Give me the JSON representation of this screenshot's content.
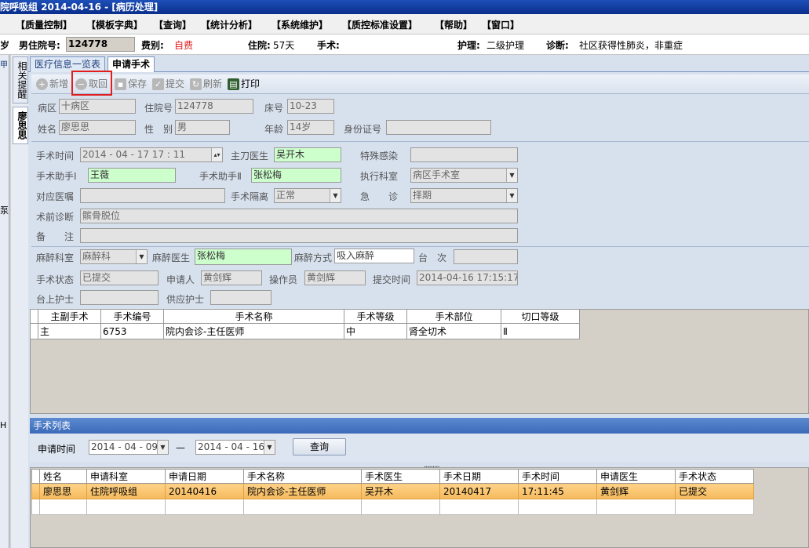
{
  "titlebar": {
    "text": "院呼吸组  2014-04-16 - [病历处理]"
  },
  "menu": [
    "【质量控制】",
    "【模板字典】",
    "【查询】",
    "【统计分析】",
    "【系统维护】",
    "【质控标准设置】",
    "【帮助】",
    "【窗口】"
  ],
  "patient": {
    "age_suffix": "岁",
    "sex_label": "男住院号:",
    "id": "124778",
    "fee_label": "费别:",
    "fee": "自费",
    "stay_label": "住院:",
    "stay": "57天",
    "surgery_label": "手术:",
    "nursing_label": "护理:",
    "nursing": "二级护理",
    "diag_label": "诊断:",
    "diag": "社区获得性肺炎，非重症"
  },
  "left_strip": {
    "t1": "甲",
    "t2": "泵",
    "t3": "H"
  },
  "vtabs": {
    "related": "相关提醒",
    "name": "廖思思"
  },
  "tabs": {
    "overview": "医疗信息一览表",
    "apply": "申请手术"
  },
  "toolbar": {
    "add": "新增",
    "withdraw": "取回",
    "save": "保存",
    "submit": "提交",
    "refresh": "刷新",
    "print": "打印"
  },
  "form": {
    "ward_l": "病区",
    "ward": "十病区",
    "inp_l": "住院号",
    "inp": "124778",
    "bed_l": "床号",
    "bed": "10-23",
    "name_l": "姓名",
    "name": "廖思思",
    "sex_l": "性　别",
    "sex": "男",
    "age_l": "年龄",
    "age": "14岁",
    "idcard_l": "身份证号",
    "optime_l": "手术时间",
    "optime": "2014 - 04 - 17    17 : 11",
    "surgeon_l": "主刀医生",
    "surgeon": "吴开木",
    "infect_l": "特殊感染",
    "asst1_l": "手术助手Ⅰ",
    "asst1": "王薇",
    "asst2_l": "手术助手Ⅱ",
    "asst2": "张松梅",
    "dept_l": "执行科室",
    "dept": "病区手术室",
    "order_l": "对应医嘱",
    "iso_l": "手术隔离",
    "iso": "正常",
    "emerg_l": "急　　诊",
    "emerg": "择期",
    "prediag_l": "术前诊断",
    "prediag": "髌骨脱位",
    "remark_l": "备　　注",
    "anes_dept_l": "麻醉科室",
    "anes_dept": "麻醉科",
    "anes_doc_l": "麻醉医生",
    "anes_doc": "张松梅",
    "anes_way_l": "麻醉方式",
    "anes_way": "吸入麻醉",
    "table_l": "台　次",
    "status_l": "手术状态",
    "status": "已提交",
    "applicant_l": "申请人",
    "applicant": "黄剑辉",
    "operator_l": "操作员",
    "operator": "黄剑辉",
    "submit_t_l": "提交时间",
    "submit_t": "2014-04-16 17:15:17",
    "nurse_l": "台上护士",
    "supply_l": "供应护士"
  },
  "op_table": {
    "headers": [
      "主副手术",
      "手术编号",
      "手术名称",
      "手术等级",
      "手术部位",
      "切口等级"
    ],
    "rows": [
      [
        "主",
        "6753",
        "院内会诊-主任医师",
        "中",
        "肾全切术",
        "Ⅱ"
      ]
    ]
  },
  "list": {
    "title": "手术列表",
    "date_l": "申请时间",
    "from": "2014 - 04 - 09",
    "to": "2014 - 04 - 16",
    "dash": "—",
    "query": "查询",
    "dots": ".........",
    "headers": [
      "姓名",
      "申请科室",
      "申请日期",
      "手术名称",
      "手术医生",
      "手术日期",
      "手术时间",
      "申请医生",
      "手术状态"
    ],
    "rows": [
      [
        "廖思思",
        "住院呼吸组",
        "20140416",
        "院内会诊-主任医师",
        "吴开木",
        "20140417",
        "17:11:45",
        "黄剑辉",
        "已提交"
      ]
    ]
  },
  "colors": {
    "highlight": "#e21d1d",
    "fee": "#e21d1d",
    "green_field": "#ccffcc"
  }
}
